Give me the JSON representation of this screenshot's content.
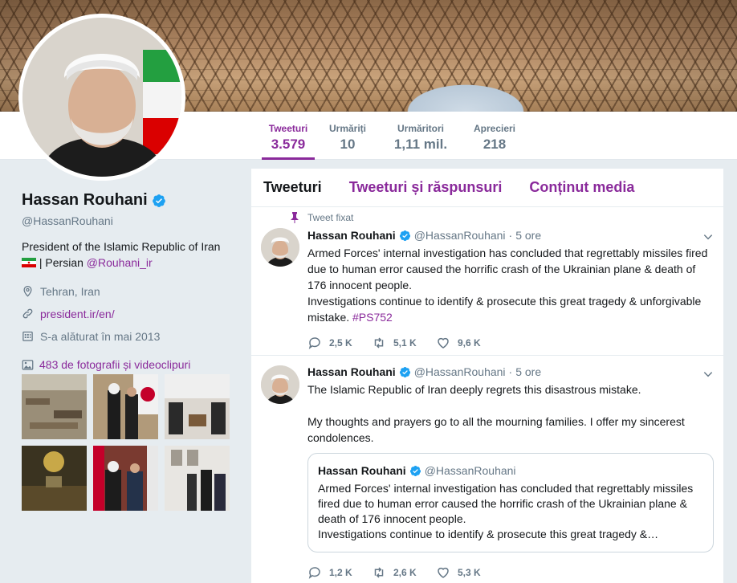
{
  "profile": {
    "name": "Hassan Rouhani",
    "handle": "@HassanRouhani",
    "bio_line1": "President of the Islamic Republic of Iran",
    "bio_line2_prefix": "| Persian",
    "bio_link": "@Rouhani_ir",
    "location": "Tehran, Iran",
    "website": "president.ir/en/",
    "joined": "S-a alăturat în mai 2013",
    "photos_label": "483 de fotografii și videoclipuri"
  },
  "stats": [
    {
      "label": "Tweeturi",
      "value": "3.579"
    },
    {
      "label": "Urmăriți",
      "value": "10"
    },
    {
      "label": "Urmăritori",
      "value": "1,11 mil."
    },
    {
      "label": "Aprecieri",
      "value": "218"
    }
  ],
  "tabs": [
    "Tweeturi",
    "Tweeturi și răspunsuri",
    "Conținut media"
  ],
  "tweets": [
    {
      "pinned_label": "Tweet fixat",
      "name": "Hassan Rouhani",
      "handle": "@HassanRouhani",
      "sep": "·",
      "time": "5 ore",
      "text": "Armed Forces' internal investigation has concluded that regrettably missiles fired due to human error caused the horrific crash of the Ukrainian plane & death of 176 innocent people.\nInvestigations continue to identify & prosecute this great tragedy & unforgivable mistake. ",
      "hashtag": "#PS752",
      "replies": "2,5 K",
      "retweets": "5,1 K",
      "likes": "9,6 K"
    },
    {
      "name": "Hassan Rouhani",
      "handle": "@HassanRouhani",
      "sep": "·",
      "time": "5 ore",
      "text": "The Islamic Republic of Iran deeply regrets this disastrous mistake.\n\nMy thoughts and prayers go to all the mourning families. I offer my sincerest condolences.",
      "quote": {
        "name": "Hassan Rouhani",
        "handle": "@HassanRouhani",
        "text": "Armed Forces' internal investigation has concluded that regrettably missiles fired due to human error caused the horrific crash of the Ukrainian plane & death of 176 innocent people.\nInvestigations continue to identify & prosecute this great tragedy &…"
      },
      "replies": "1,2 K",
      "retweets": "2,6 K",
      "likes": "5,3 K"
    }
  ],
  "colors": {
    "accent": "#8a2a9b",
    "verified": "#1da1f2",
    "muted": "#657786"
  }
}
